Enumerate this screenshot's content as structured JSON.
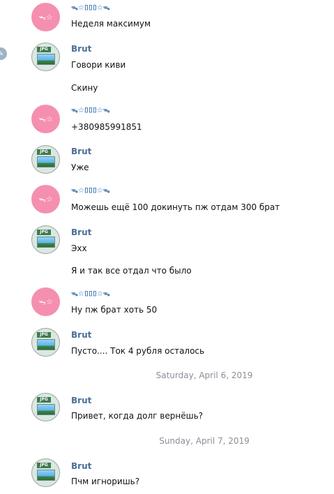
{
  "contacts": {
    "pink_name": "ᯓ☆⌷⌷⌷☆ᯓ",
    "pink_avatar_glyph": "ᯓ☆",
    "brut_name": "Brut",
    "jpg_label": "JPG"
  },
  "messages": [
    {
      "text": "Неделя максимум"
    },
    {
      "text": "Говори киви"
    },
    {
      "text": "Скину"
    },
    {
      "text": "+380985991851"
    },
    {
      "text": "Уже"
    },
    {
      "text": "Можешь ещё 100 докинуть пж отдам 300 брат"
    },
    {
      "text": "Эхх"
    },
    {
      "text": "Я и так все отдал что было"
    },
    {
      "text": "Ну пж брат хоть 50"
    },
    {
      "text": "Пусто.... Ток 4 рубля осталось"
    },
    {
      "text": "Привет, когда долг вернёшь?"
    },
    {
      "text": "Пчм игноришь?"
    }
  ],
  "dates": {
    "d1": "Saturday, April 6, 2019",
    "d2": "Sunday, April 7, 2019"
  },
  "colors": {
    "pink_avatar": "#f58fb0",
    "name_blue": "#4a6f99",
    "date_gray": "#8a8f98"
  }
}
